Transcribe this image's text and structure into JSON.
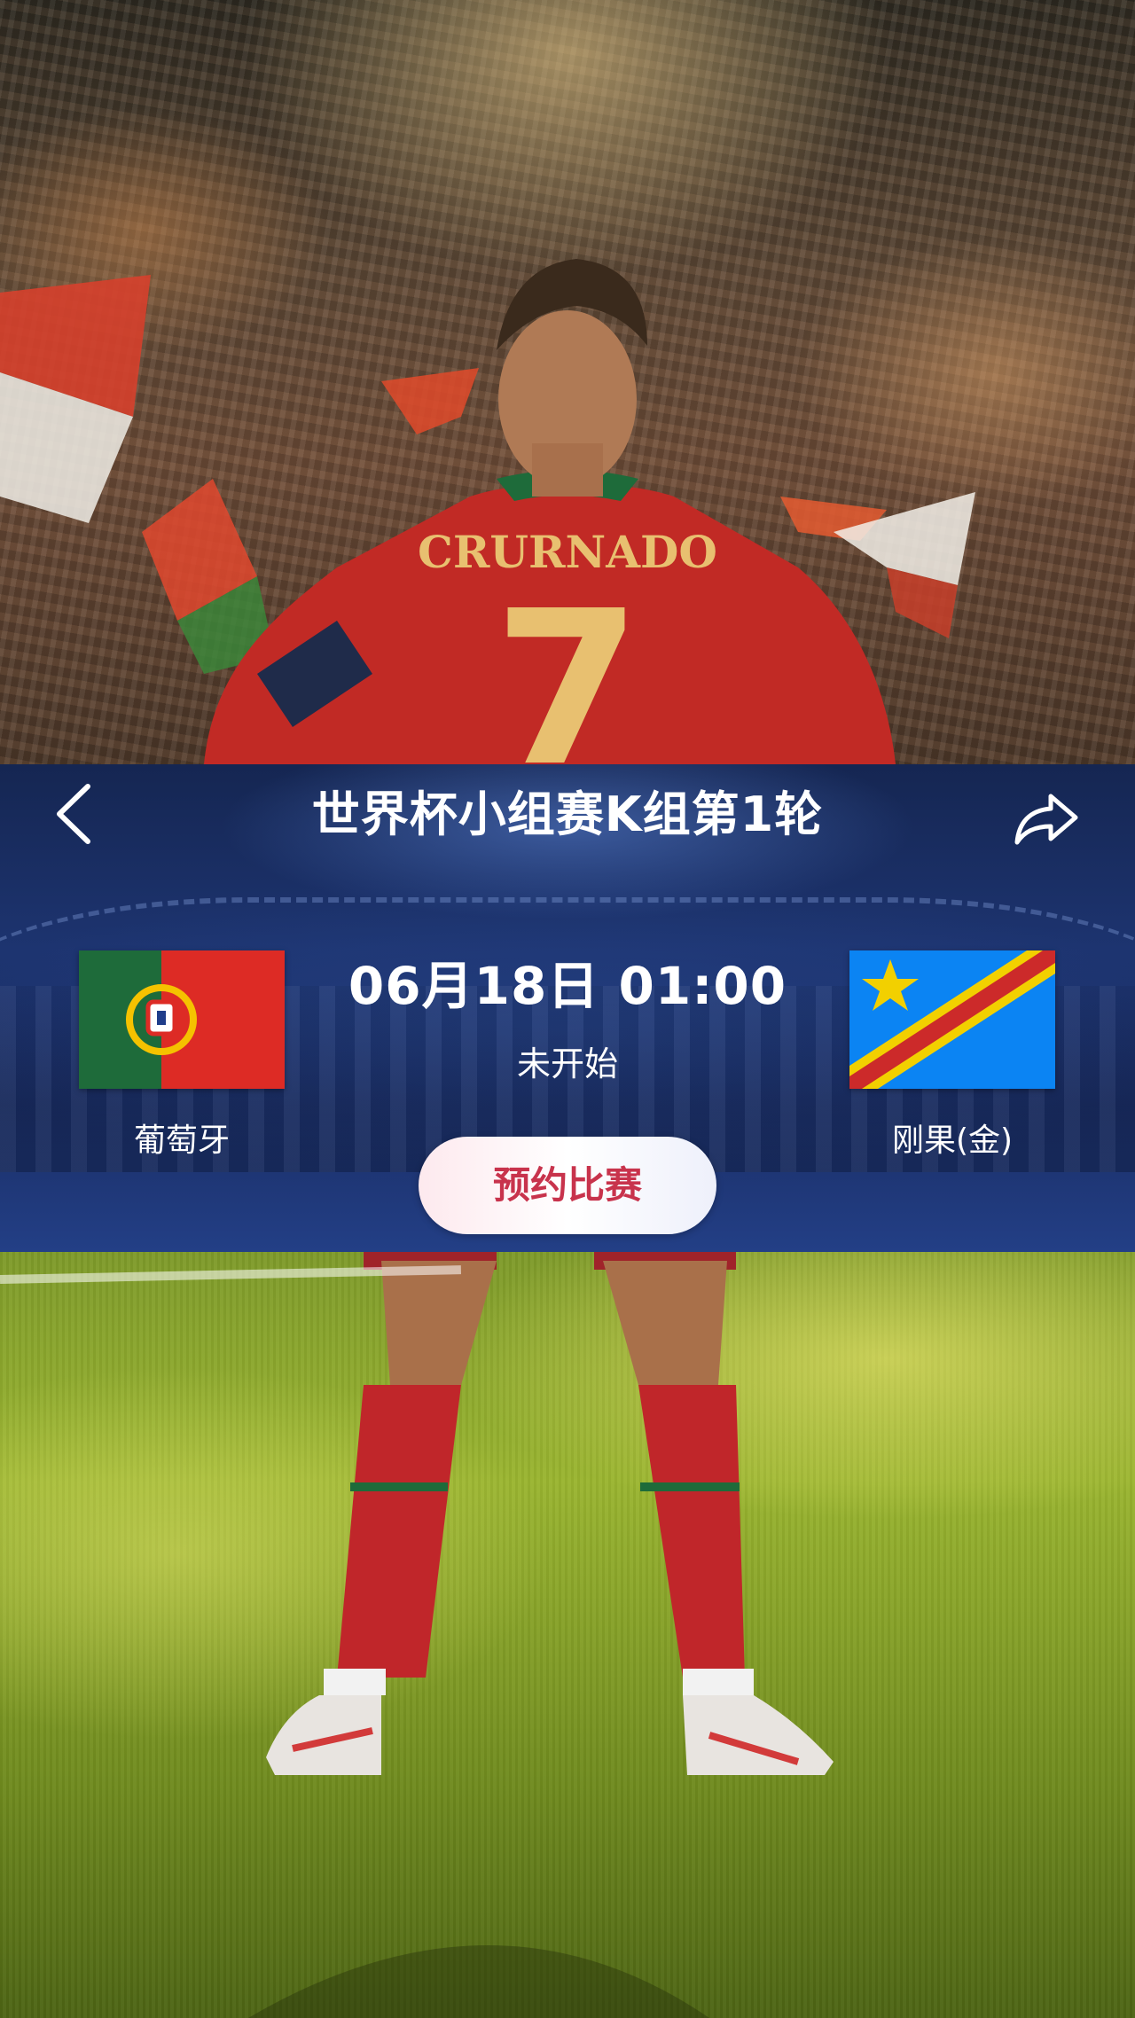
{
  "header": {
    "title": "世界杯小组赛K组第1轮",
    "back_icon": "chevron-left-icon",
    "share_icon": "share-icon"
  },
  "match": {
    "time": "06月18日 01:00",
    "status": "未开始",
    "reserve_label": "预约比赛",
    "home": {
      "name": "葡萄牙",
      "flag": "portugal-flag",
      "colors": {
        "green": "#006600",
        "red": "#dd2b25",
        "gold": "#f5c200"
      }
    },
    "away": {
      "name": "刚果(金)",
      "flag": "dr-congo-flag",
      "colors": {
        "blue": "#0b84f3",
        "red": "#cc2a2a",
        "yellow": "#f2d000"
      }
    }
  },
  "theme": {
    "panel_bg": "#1d3470",
    "reserve_text_color": "#c8334c"
  }
}
